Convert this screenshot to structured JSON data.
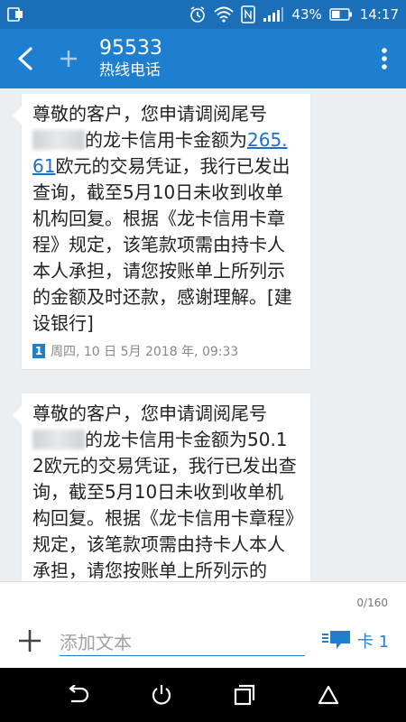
{
  "status_bar": {
    "battery_percent": "43%",
    "time": "14:17"
  },
  "header": {
    "title": "95533",
    "subtitle": "热线电话"
  },
  "messages": [
    {
      "text_before_mask": "尊敬的客户，您申请调阅尾号",
      "text_after_mask": "的龙卡信用卡金额为",
      "amount": "265.61",
      "text_after_amount": "欧元的交易凭证，我行已发出查询，截至5月10日未收到收单机构回复。根据《龙卡信用卡章程》规定，该笔款项需由持卡人本人承担，请您按账单上所列示的金额及时还款，感谢理解。[建设银行]",
      "sim": "1",
      "timestamp": "周四, 10 日 5月 2018 年, 09:33"
    },
    {
      "text_before_mask": "尊敬的客户，您申请调阅尾号",
      "text_after_mask": "的龙卡信用卡金额为50.12欧元的交易凭证，我行已发出查询，截至5月10日未收到收单机构回复。根据《龙卡信用卡章程》规定，该笔款项需由持卡人本人承担，请您按账单上所列示的",
      "amount": "",
      "text_after_amount": ""
    }
  ],
  "compose": {
    "char_count": "0/160",
    "placeholder": "添加文本",
    "send_label": "卡 1"
  },
  "colors": {
    "status_bar": "#1b6fb8",
    "app_bar": "#1e7fd0",
    "accent": "#1e7fd0"
  },
  "icons": {
    "back": "back-arrow-icon",
    "add_contact": "plus-icon",
    "menu": "more-vert-icon",
    "attach": "plus-icon",
    "send": "message-send-icon",
    "nav_back": "nav-back-icon",
    "nav_home": "power-home-icon",
    "nav_recents": "recents-icon",
    "nav_up": "home-triangle-icon"
  }
}
